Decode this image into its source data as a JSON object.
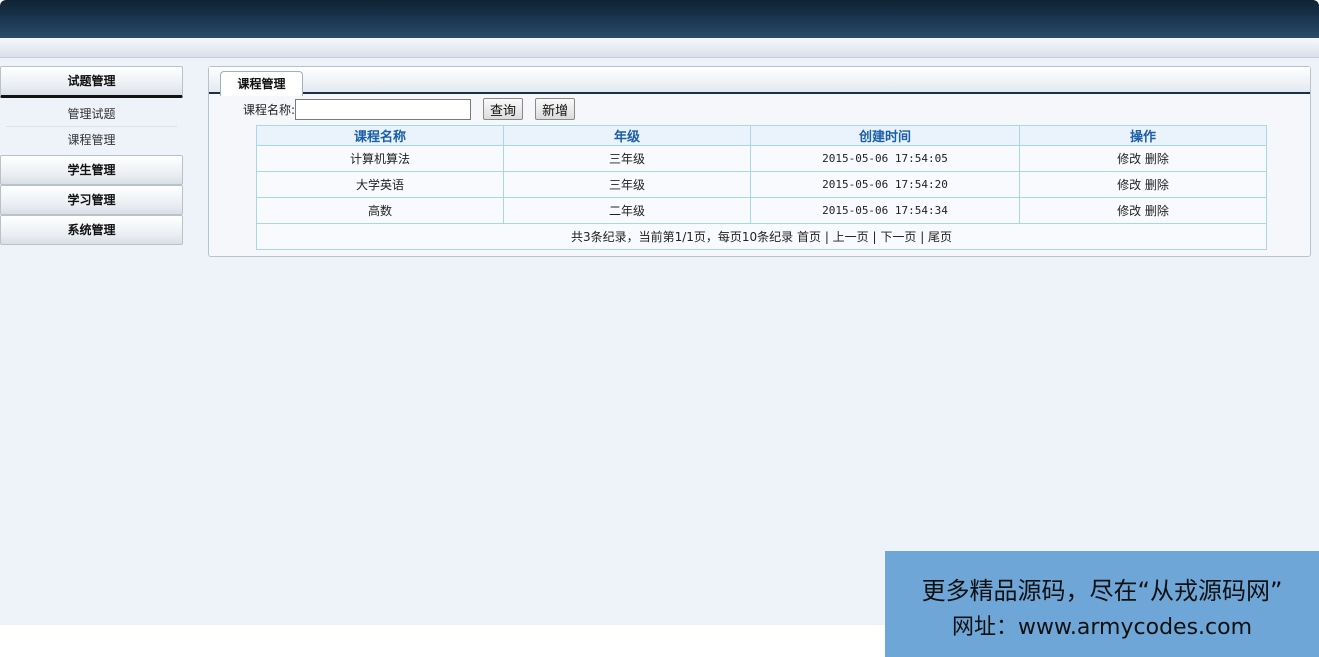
{
  "sidebar": {
    "groups": [
      {
        "label": "试题管理",
        "items": [
          "管理试题",
          "课程管理"
        ]
      },
      {
        "label": "学生管理"
      },
      {
        "label": "学习管理"
      },
      {
        "label": "系统管理"
      }
    ]
  },
  "panel": {
    "tab_label": "课程管理",
    "search": {
      "label": "课程名称:",
      "value": "",
      "query_button": "查询",
      "add_button": "新增"
    }
  },
  "table": {
    "columns": [
      "课程名称",
      "年级",
      "创建时间",
      "操作"
    ],
    "rows": [
      {
        "name": "计算机算法",
        "grade": "三年级",
        "created": "2015-05-06 17:54:05",
        "edit": "修改",
        "delete": "删除"
      },
      {
        "name": "大学英语",
        "grade": "三年级",
        "created": "2015-05-06 17:54:20",
        "edit": "修改",
        "delete": "删除"
      },
      {
        "name": "高数",
        "grade": "二年级",
        "created": "2015-05-06 17:54:34",
        "edit": "修改",
        "delete": "删除"
      }
    ],
    "pager": {
      "summary": "共3条纪录，当前第1/1页，每页10条纪录",
      "first": "首页",
      "prev": "上一页",
      "next": "下一页",
      "last": "尾页"
    }
  },
  "watermark": {
    "line1": "更多精品源码，尽在“从戎源码网”",
    "line2": "网址：www.armycodes.com"
  },
  "colors": {
    "header_dark": "#1d3a55",
    "table_header_text": "#1a5fa8",
    "workarea_bg": "#eef2f9",
    "watermark_bg": "#6fa6d8"
  }
}
